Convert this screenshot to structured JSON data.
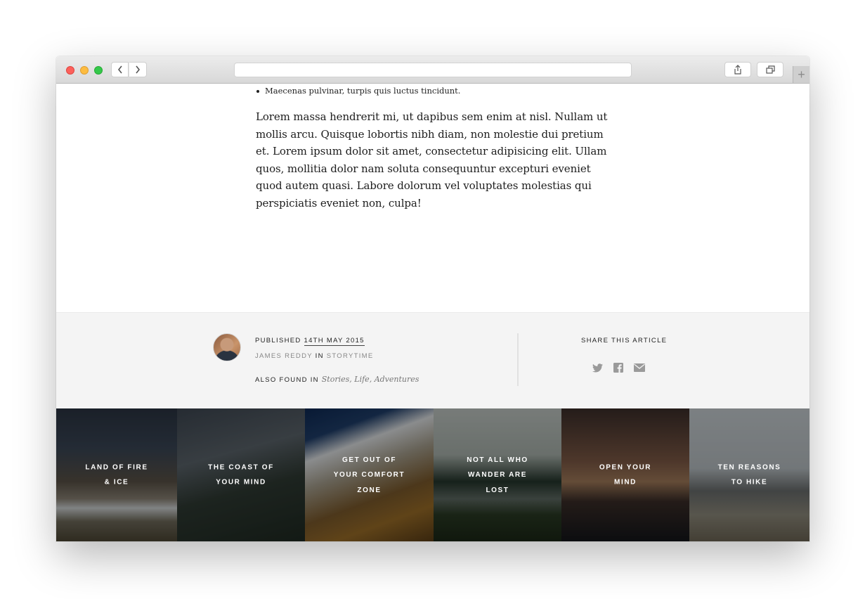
{
  "article": {
    "bullet": "Maecenas pulvinar, turpis quis luctus tincidunt.",
    "paragraph": "Lorem massa hendrerit mi, ut dapibus sem enim at nisl. Nullam ut mollis arcu. Quisque lobortis nibh diam, non molestie dui pretium et. Lorem ipsum dolor sit amet, consectetur adipisicing elit. Ullam quos, mollitia dolor nam soluta consequuntur excepturi eveniet quod autem quasi. Labore dolorum vel voluptates molestias qui perspiciatis eveniet non, culpa!"
  },
  "meta": {
    "published_label": "PUBLISHED",
    "published_date": "14TH MAY 2015",
    "author": "JAMES REDDY",
    "in_label": "IN",
    "category": "STORYTIME",
    "also_found_label": "ALSO FOUND IN",
    "tags": [
      "Stories",
      "Life",
      "Adventures"
    ],
    "share_title": "SHARE THIS ARTICLE",
    "share_icons": [
      "twitter-icon",
      "facebook-icon",
      "mail-icon"
    ]
  },
  "tiles": [
    {
      "title": "LAND OF FIRE & ICE"
    },
    {
      "title": "THE COAST OF YOUR MIND"
    },
    {
      "title": "GET OUT OF YOUR COMFORT ZONE"
    },
    {
      "title": "NOT ALL WHO WANDER ARE LOST"
    },
    {
      "title": "OPEN YOUR MIND"
    },
    {
      "title": "TEN REASONS TO HIKE"
    }
  ],
  "colors": {
    "footer_bg": "#f4f4f4",
    "share_icon": "#999999",
    "traffic_red": "#fc605b",
    "traffic_yellow": "#fdbc40",
    "traffic_green": "#34c84a"
  }
}
